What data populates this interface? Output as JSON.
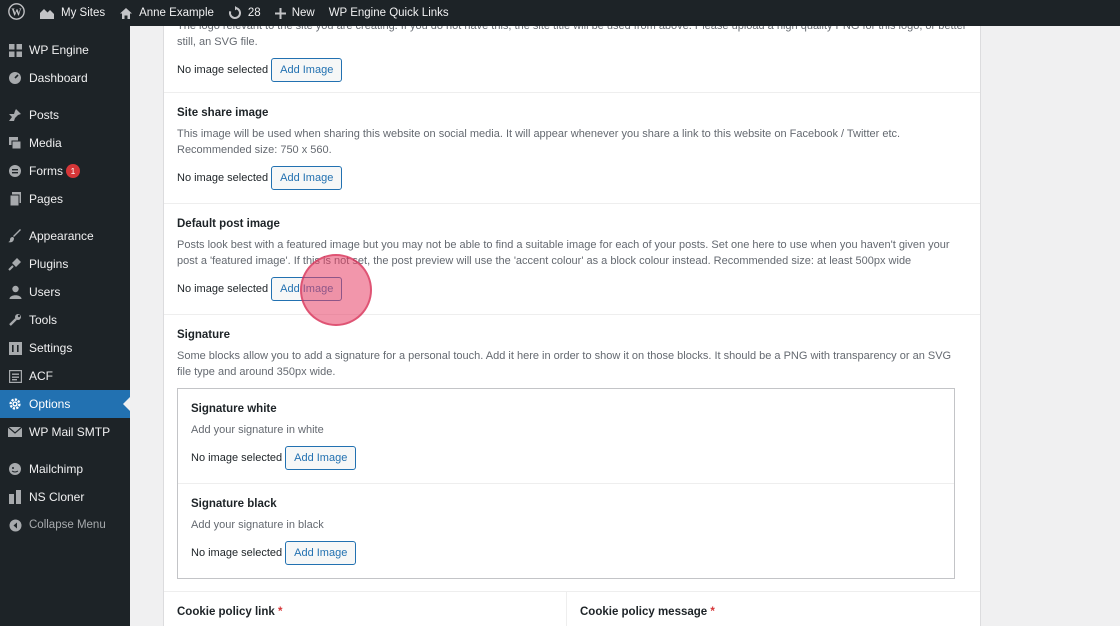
{
  "adminbar": {
    "my_sites": "My Sites",
    "site_name": "Anne Example",
    "updates_count": "28",
    "new_label": "New",
    "quick_links": "WP Engine Quick Links"
  },
  "sidebar": {
    "items": [
      {
        "label": "WP Engine",
        "icon": "grid-icon"
      },
      {
        "label": "Dashboard",
        "icon": "dashboard-icon"
      },
      {
        "label": "Posts",
        "icon": "pin-icon"
      },
      {
        "label": "Media",
        "icon": "media-icon"
      },
      {
        "label": "Forms",
        "icon": "forms-icon",
        "badge": "1"
      },
      {
        "label": "Pages",
        "icon": "pages-icon"
      },
      {
        "label": "Appearance",
        "icon": "brush-icon"
      },
      {
        "label": "Plugins",
        "icon": "plug-icon"
      },
      {
        "label": "Users",
        "icon": "user-icon"
      },
      {
        "label": "Tools",
        "icon": "wrench-icon"
      },
      {
        "label": "Settings",
        "icon": "settings-icon"
      },
      {
        "label": "ACF",
        "icon": "acf-icon"
      },
      {
        "label": "Options",
        "icon": "gear-icon",
        "current": true
      },
      {
        "label": "WP Mail SMTP",
        "icon": "mail-icon"
      },
      {
        "label": "Mailchimp",
        "icon": "mailchimp-icon"
      },
      {
        "label": "NS Cloner",
        "icon": "cloner-icon"
      },
      {
        "label": "Collapse Menu",
        "icon": "collapse-icon"
      }
    ]
  },
  "fields": {
    "logo": {
      "desc_top": "The logo relevant to the site you are creating. If you do not have this, the site title will be used from above. Please upload a high quality PNG for this logo, or better",
      "desc_bottom": "still, an SVG file.",
      "status": "No image selected",
      "button": "Add Image"
    },
    "share": {
      "label": "Site share image",
      "desc": "This image will be used when sharing this website on social media. It will appear whenever you share a link to this website on Facebook / Twitter etc. Recommended size: 750 x 560.",
      "status": "No image selected",
      "button": "Add Image"
    },
    "default_post": {
      "label": "Default post image",
      "desc": "Posts look best with a featured image but you may not be able to find a suitable image for each of your posts. Set one here to use when you haven't given your post a 'featured image'. If this is not set, the post preview will use the 'accent colour' as a block colour instead. Recommended size: at least 500px wide",
      "status": "No image selected",
      "button": "Add Image"
    },
    "signature": {
      "label": "Signature",
      "desc": "Some blocks allow you to add a signature for a personal touch. Add it here in order to show it on those blocks. It should be a PNG with transparency or an SVG file type and around 350px wide.",
      "white": {
        "label": "Signature white",
        "desc": "Add your signature in white",
        "status": "No image selected",
        "button": "Add Image"
      },
      "black": {
        "label": "Signature black",
        "desc": "Add your signature in black",
        "status": "No image selected",
        "button": "Add Image"
      }
    },
    "cookie_link": {
      "label": "Cookie policy link",
      "required": "*"
    },
    "cookie_message": {
      "label": "Cookie policy message",
      "required": "*"
    }
  },
  "colors": {
    "accent": "#2271b1",
    "adminbar": "#1d2327",
    "badge": "#d63638"
  }
}
